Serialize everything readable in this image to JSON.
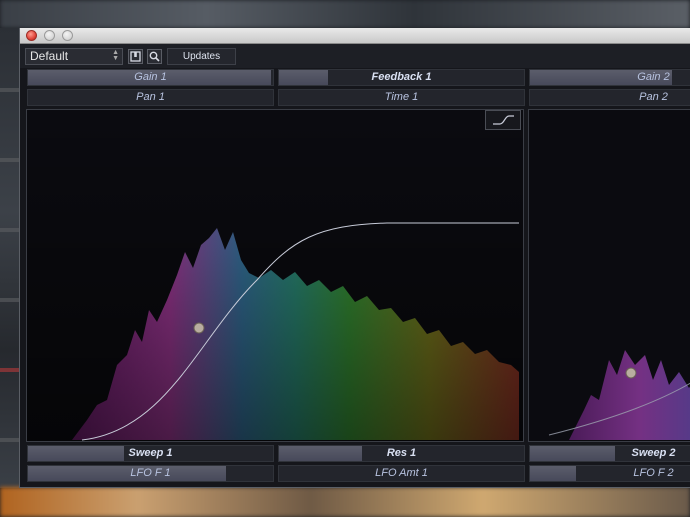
{
  "toolbar": {
    "preset_value": "Default",
    "updates_label": "Updates"
  },
  "params": {
    "gain_1": {
      "label": "Gain 1",
      "level": 0.99
    },
    "feedback_1": {
      "label": "Feedback 1",
      "level": 0.2
    },
    "gain_2": {
      "label": "Gain 2",
      "level": 0.8
    },
    "pan_1": {
      "label": "Pan 1",
      "level": 0.0
    },
    "time_1": {
      "label": "Time 1",
      "level": 0.0
    },
    "pan_2": {
      "label": "Pan 2",
      "level": 0.0
    },
    "sweep_1": {
      "label": "Sweep 1",
      "level": 0.39
    },
    "res_1": {
      "label": "Res 1",
      "level": 0.34
    },
    "sweep_2": {
      "label": "Sweep 2",
      "level": 0.48
    },
    "lfo_f_1": {
      "label": "LFO F 1",
      "level": 0.81
    },
    "lfo_amt_1": {
      "label": "LFO Amt 1",
      "level": 0.0
    },
    "lfo_f_2": {
      "label": "LFO F 2",
      "level": 0.26
    }
  },
  "icons": {
    "save": "save-icon",
    "search": "magnifier-icon",
    "shape": "sigmoid-curve-icon"
  }
}
